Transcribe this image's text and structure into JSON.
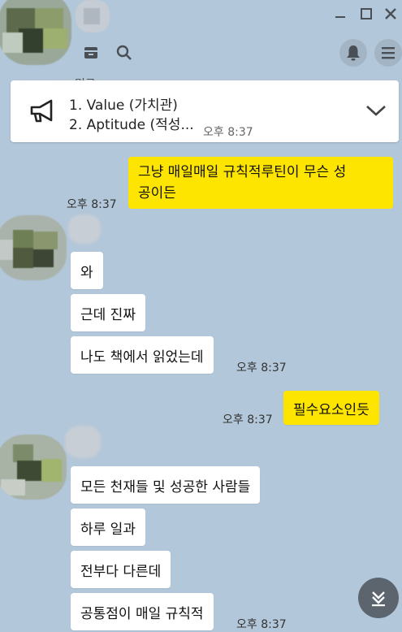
{
  "notice": {
    "line1": "1. Value (가치관)",
    "line2": "2. Aptitude (적성..."
  },
  "messages": {
    "m1_line1": "그냥 매일매일 규칙적루틴이 무슨 성",
    "m1_line2": "공이든",
    "m1_time": "오후 8:37",
    "m2": "와",
    "m3": "근데 진짜",
    "m4": "나도 책에서 읽었는데",
    "m4_time": "오후 8:37",
    "m5": "필수요소인듯",
    "m5_time": "오후 8:37",
    "m6": "모든 천재들 및 성공한 사람들",
    "m7": "하루 일과",
    "m8": "전부다 다른데",
    "m9": "공통점이 매일 규칙적",
    "m9_time": "오후 8:37"
  },
  "partial_time": "오후 8:37",
  "partial_name": "민규",
  "icons": [
    "minimize-icon",
    "maximize-icon",
    "close-icon",
    "archive-icon",
    "search-icon",
    "bell-icon",
    "menu-icon",
    "megaphone-icon",
    "chevron-down-icon",
    "scroll-down-icon"
  ],
  "colors": {
    "background": "#b2c7d9",
    "my_bubble": "#fee500",
    "their_bubble": "#ffffff"
  }
}
